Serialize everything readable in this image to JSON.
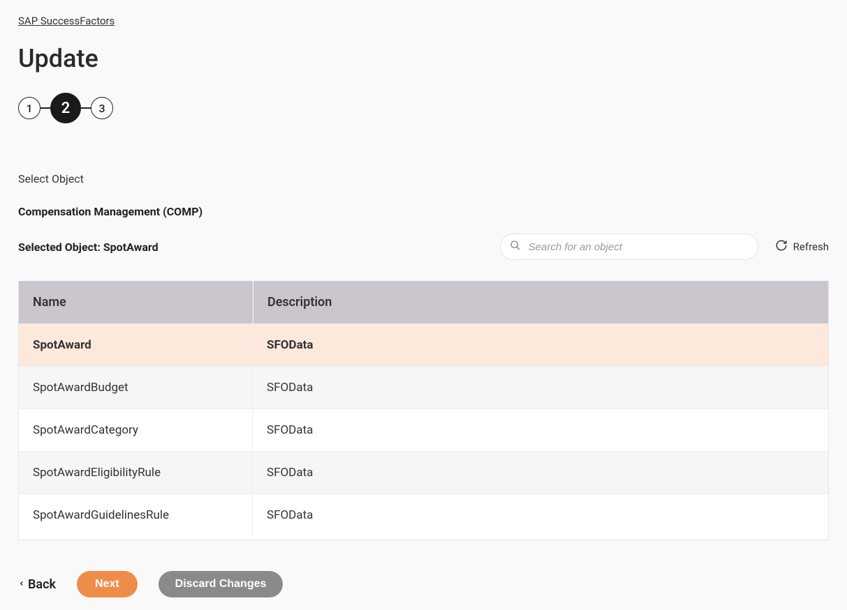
{
  "breadcrumb": "SAP SuccessFactors",
  "page_title": "Update",
  "stepper": {
    "steps": [
      "1",
      "2",
      "3"
    ],
    "active_index": 1
  },
  "section_label": "Select Object",
  "category_label": "Compensation Management (COMP)",
  "selected_object_label": "Selected Object: SpotAward",
  "search": {
    "placeholder": "Search for an object"
  },
  "refresh_label": "Refresh",
  "table": {
    "headers": {
      "name": "Name",
      "description": "Description"
    },
    "rows": [
      {
        "name": "SpotAward",
        "description": "SFOData",
        "selected": true
      },
      {
        "name": "SpotAwardBudget",
        "description": "SFOData",
        "selected": false
      },
      {
        "name": "SpotAwardCategory",
        "description": "SFOData",
        "selected": false
      },
      {
        "name": "SpotAwardEligibilityRule",
        "description": "SFOData",
        "selected": false
      },
      {
        "name": "SpotAwardGuidelinesRule",
        "description": "SFOData",
        "selected": false
      }
    ]
  },
  "footer": {
    "back": "Back",
    "next": "Next",
    "discard": "Discard Changes"
  }
}
